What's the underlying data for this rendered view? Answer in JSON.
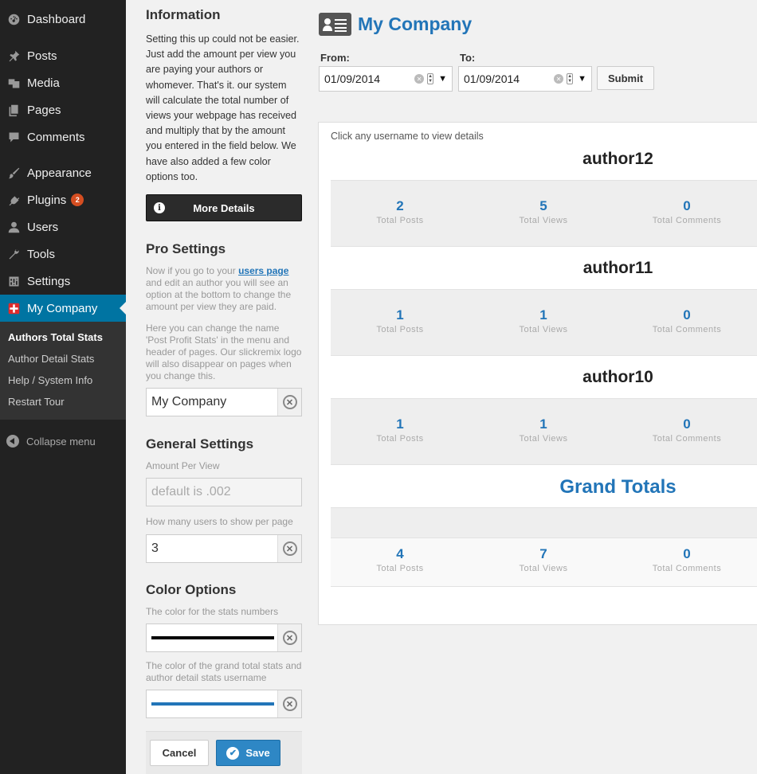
{
  "sidebar": {
    "items": [
      {
        "label": "Dashboard",
        "icon": "dashboard-icon"
      },
      {
        "label": "Posts",
        "icon": "pin-icon"
      },
      {
        "label": "Media",
        "icon": "media-icon"
      },
      {
        "label": "Pages",
        "icon": "pages-icon"
      },
      {
        "label": "Comments",
        "icon": "comment-icon"
      },
      {
        "label": "Appearance",
        "icon": "brush-icon"
      },
      {
        "label": "Plugins",
        "icon": "plug-icon",
        "badge": "2"
      },
      {
        "label": "Users",
        "icon": "user-icon"
      },
      {
        "label": "Tools",
        "icon": "wrench-icon"
      },
      {
        "label": "Settings",
        "icon": "settings-icon"
      },
      {
        "label": "My Company",
        "icon": "plugin-logo-icon"
      }
    ],
    "submenu": [
      "Authors Total Stats",
      "Author Detail Stats",
      "Help / System Info",
      "Restart Tour"
    ],
    "collapse_label": "Collapse menu"
  },
  "settings": {
    "info_title": "Information",
    "info_text": "Setting this up could not be easier. Just add the amount per view you are paying your authors or whomever. That's it. our system will calculate the total number of views your webpage has received and multiply that by the amount you entered in the field below. We have also added a few color options too.",
    "more_details": "More Details",
    "pro_title": "Pro Settings",
    "pro_text_1a": "Now if you go to your ",
    "pro_link": "users page",
    "pro_text_1b": " and edit an author you will see an option at the bottom to change the amount per view they are paid.",
    "pro_text_2": "Here you can change the name 'Post Profit Stats' in the menu and header of pages. Our slickremix logo will also disappear on pages when you change this.",
    "company_name_value": "My Company",
    "general_title": "General Settings",
    "amount_label": "Amount Per View",
    "amount_placeholder": "default is .002",
    "users_per_page_label": "How many users to show per page",
    "users_per_page_value": "3",
    "color_title": "Color Options",
    "color_numbers_label": "The color for the stats numbers",
    "color_numbers_value": "#000000",
    "color_grand_label": "The color of the grand total stats and author detail stats username",
    "color_grand_value": "#2275b8",
    "cancel": "Cancel",
    "save": "Save"
  },
  "main": {
    "title": "My Company",
    "from_label": "From:",
    "from_value": "01/09/2014",
    "to_label": "To:",
    "to_value": "01/09/2014",
    "submit": "Submit",
    "hint": "Click any username to view details",
    "authors": [
      {
        "name": "author12",
        "posts": "2",
        "views": "5",
        "comments": "0"
      },
      {
        "name": "author11",
        "posts": "1",
        "views": "1",
        "comments": "0"
      },
      {
        "name": "author10",
        "posts": "1",
        "views": "1",
        "comments": "0"
      }
    ],
    "stat_labels": {
      "posts": "Total Posts",
      "views": "Total Views",
      "comments": "Total Comments"
    },
    "grand_title": "Grand Totals",
    "grand": {
      "posts": "4",
      "views": "7",
      "comments": "0"
    }
  },
  "colors": {
    "accent": "#2275b8",
    "sidebar_bg": "#222222",
    "current_menu": "#0074a2",
    "badge": "#d54e21"
  }
}
